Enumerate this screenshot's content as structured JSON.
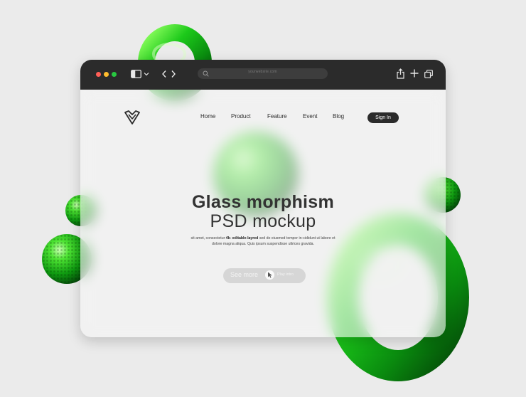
{
  "browser": {
    "url": "yourwebsite.com",
    "icons": [
      "sidebar-icon",
      "chevron-down-icon",
      "back-icon",
      "forward-icon",
      "search-icon",
      "share-icon",
      "plus-icon",
      "tabs-icon"
    ],
    "traffic_lights": [
      "#ff5f57",
      "#febc2e",
      "#28c840"
    ]
  },
  "nav": {
    "logo": "v-logo-icon",
    "items": [
      "Home",
      "Product",
      "Feature",
      "Event",
      "Blog"
    ],
    "signin": "Sign In"
  },
  "hero": {
    "title_line1": "Glass morphism",
    "title_line2": "PSD mockup",
    "body_before": "sit amet, consectetur ",
    "body_bold": "4k- editable-layred",
    "body_after": " sed do eiusmod tempor in-cididunt ut labore et dolore magna aliqua. Quis ipsum suspendisse ultrices gravida.",
    "cta_primary": "See more",
    "cta_secondary": "Play intro"
  },
  "colors": {
    "accent_green": "#22c41c",
    "dark": "#2b2b2b"
  }
}
